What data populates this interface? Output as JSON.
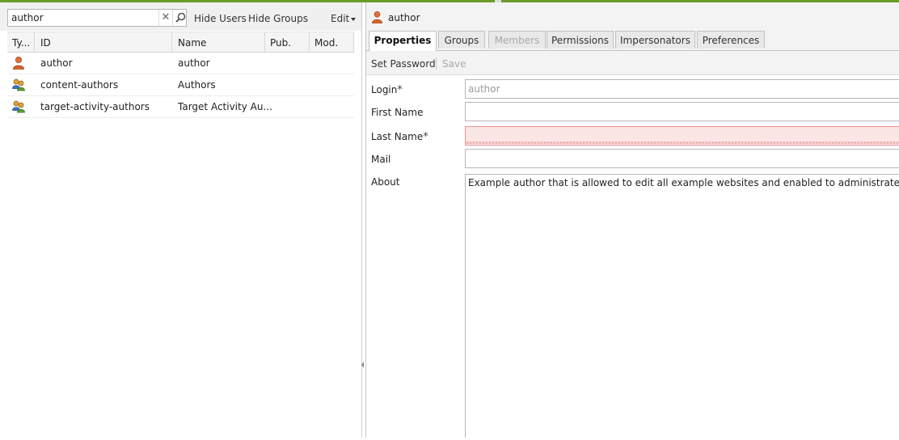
{
  "search": {
    "value": "author"
  },
  "toolbar": {
    "hide_users": "Hide Users",
    "hide_groups": "Hide Groups",
    "edit": "Edit"
  },
  "grid": {
    "columns": [
      "Ty...",
      "ID",
      "Name",
      "Pub.",
      "Mod."
    ],
    "rows": [
      {
        "type": "user-icon",
        "id": "author",
        "name": "author",
        "pub": "",
        "mod": ""
      },
      {
        "type": "group-icon",
        "id": "content-authors",
        "name": "Authors",
        "pub": "",
        "mod": ""
      },
      {
        "type": "group-icon",
        "id": "target-activity-authors",
        "name": "Target Activity Au...",
        "pub": "",
        "mod": ""
      }
    ]
  },
  "detail": {
    "title": "author",
    "tabs": [
      {
        "label": "Properties",
        "state": "active"
      },
      {
        "label": "Groups",
        "state": "normal"
      },
      {
        "label": "Members",
        "state": "disabled"
      },
      {
        "label": "Permissions",
        "state": "normal"
      },
      {
        "label": "Impersonators",
        "state": "normal"
      },
      {
        "label": "Preferences",
        "state": "normal"
      }
    ],
    "actions": {
      "set_password": "Set Password",
      "save": "Save"
    },
    "form": {
      "login_label": "Login",
      "login_value": "author",
      "first_name_label": "First Name",
      "first_name_value": "",
      "last_name_label": "Last Name",
      "last_name_value": "",
      "mail_label": "Mail",
      "mail_value": "",
      "about_label": "About",
      "about_value": "Example author that is allowed to edit all example websites and enabled to administrate workflows.",
      "required_mark": "*"
    }
  },
  "colors": {
    "accent_bar": "#6b9a2d",
    "invalid_bg": "#fbe6e6",
    "invalid_border": "#e79797"
  }
}
